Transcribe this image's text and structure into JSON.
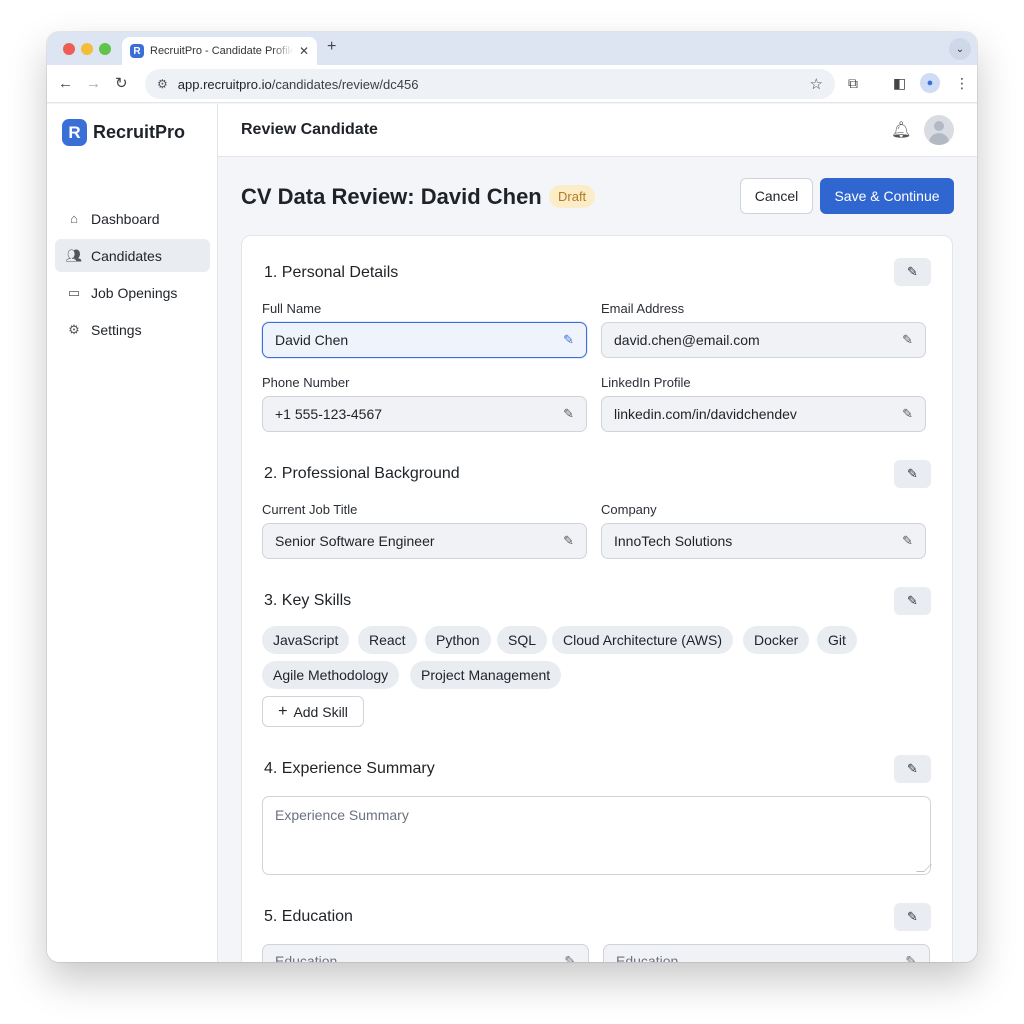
{
  "browser": {
    "tab_title": "RecruitPro - Candidate Profile",
    "tab_favicon": "R",
    "url_host": "app.recruitpro.io",
    "url_path": "/candidates/review/dc456"
  },
  "app": {
    "brand": "RecruitPro",
    "brand_logo": "R",
    "nav": [
      {
        "label": "Dashboard",
        "icon": "home-icon"
      },
      {
        "label": "Candidates",
        "icon": "users-icon",
        "active": true
      },
      {
        "label": "Job Openings",
        "icon": "briefcase-icon"
      },
      {
        "label": "Settings",
        "icon": "gear-icon"
      }
    ],
    "topbar_title": "Review Candidate"
  },
  "page": {
    "title": "CV Data Review: David Chen",
    "status_badge": "Draft",
    "cancel_label": "Cancel",
    "save_label": "Save & Continue"
  },
  "sections": {
    "personal": {
      "title": "1. Personal Details",
      "full_name_label": "Full Name",
      "full_name": "David Chen",
      "email_label": "Email Address",
      "email": "david.chen@email.com",
      "phone_label": "Phone Number",
      "phone": "+1 555-123-4567",
      "linkedin_label": "LinkedIn Profile",
      "linkedin": "linkedin.com/in/davidchendev"
    },
    "professional": {
      "title": "2. Professional Background",
      "job_title_label": "Current Job Title",
      "job_title": "Senior Software Engineer",
      "company_label": "Company",
      "company": "InnoTech Solutions"
    },
    "skills": {
      "title": "3. Key Skills",
      "items": [
        "JavaScript",
        "React",
        "Python",
        "SQL",
        "Cloud Architecture (AWS)",
        "Docker",
        "Git",
        "Agile Methodology",
        "Project Management"
      ],
      "add_label": "Add Skill"
    },
    "experience": {
      "title": "4. Experience Summary",
      "placeholder": "Experience Summary"
    },
    "education": {
      "title": "5. Education",
      "field_1": "Education",
      "field_2": "Education"
    }
  },
  "colors": {
    "primary": "#2f66cf",
    "badge_bg": "#fbedc8",
    "badge_text": "#b7791f",
    "focused_border": "#3b6fd8"
  }
}
